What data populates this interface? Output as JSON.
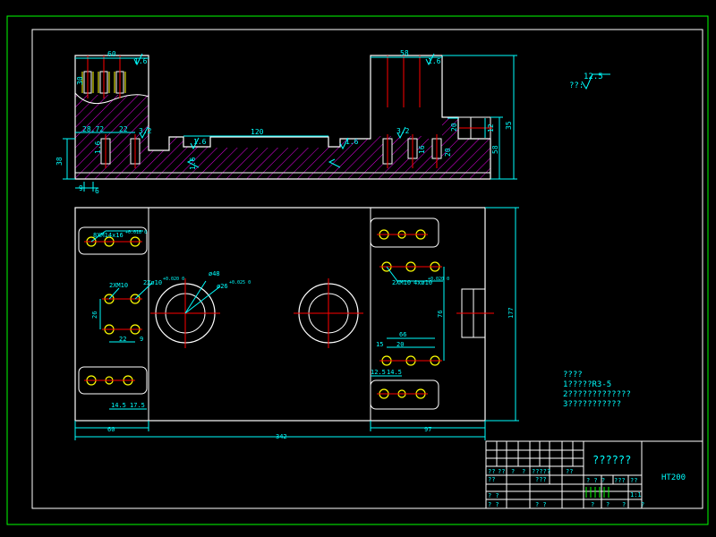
{
  "colors": {
    "background": "#000000",
    "outline": "#ffffff",
    "dimension": "#00ffff",
    "hatch": "#ff00ff",
    "centerline": "#ff0000",
    "hole": "#ffff00",
    "frame": "#00ff00"
  },
  "drawing": {
    "front_view_dims": {
      "d60": "60",
      "d58": "58",
      "d35": "35",
      "d58r": "58",
      "d38": "38",
      "d120": "120",
      "d2872": "28,72",
      "d22": "22",
      "d30": "30",
      "d12": "12",
      "d20": "20",
      "d20b": "20",
      "d16": "16",
      "d9": "9",
      "d6": "6",
      "r16a": "1.6",
      "r16b": "1.6",
      "r16c": "1.6",
      "r16d": "1.6",
      "r16e": "1.6",
      "r32a": "3.2",
      "r32b": "3.2",
      "d16b": "1.6"
    },
    "top_view_dims": {
      "hole_tl": "8XM14x16",
      "hole_tl_tol": "+0.018 0",
      "hole_ml": "2XM10",
      "hole_ml2": "2Xø10",
      "hole_ml2_tol": "+0.020 0",
      "bore_outer": "ø48",
      "bore_inner": "ø26",
      "bore_inner_tol": "+0.025 0",
      "hole_r": "2XM10",
      "hole_r2": "4xø10",
      "hole_r2_tol": "+0.020 0",
      "d26": "26",
      "d22": "22",
      "d9": "9",
      "d66": "66",
      "d15": "15",
      "d20": "20",
      "d76": "76",
      "d125": "12.5",
      "d145": "14.5",
      "d145b": "14.5",
      "d175": "17.5",
      "d60": "60",
      "d97": "97",
      "d342": "342",
      "d177": "177"
    },
    "roughness": {
      "value": "12.5",
      "prefix": "??:"
    },
    "notes": {
      "title": "????",
      "line1": "1?????R3-5",
      "line2": "2?????????????",
      "line3": "3???????????"
    },
    "title_block": {
      "name": "??????",
      "material": "HT200",
      "scale": "1:1",
      "r1": [
        "??",
        "??",
        "?",
        "?",
        "?????",
        "??"
      ],
      "r2a": "??",
      "r2b": "???",
      "r3a": "? ?",
      "r3b": "? ? ?",
      "r3c": "???",
      "r3d": "??",
      "r4a": "? ?",
      "r4b": "? ?",
      "r4c": "?",
      "r4d": "?",
      "r4e": "?",
      "r4f": "?"
    }
  }
}
